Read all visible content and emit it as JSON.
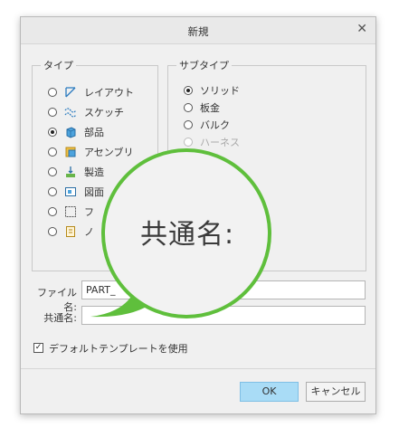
{
  "dialog": {
    "title": "新規",
    "close_glyph": "✕"
  },
  "type_group": {
    "legend": "タイプ",
    "options": [
      {
        "label": "レイアウト",
        "selected": false,
        "icon": "layout-icon"
      },
      {
        "label": "スケッチ",
        "selected": false,
        "icon": "sketch-icon"
      },
      {
        "label": "部品",
        "selected": true,
        "icon": "part-icon"
      },
      {
        "label": "アセンブリ",
        "selected": false,
        "icon": "assembly-icon"
      },
      {
        "label": "製造",
        "selected": false,
        "icon": "manufacturing-icon"
      },
      {
        "label": "図面",
        "selected": false,
        "icon": "drawing-icon"
      },
      {
        "label": "フ",
        "selected": false,
        "icon": "format-icon"
      },
      {
        "label": "ノ",
        "selected": false,
        "icon": "notebook-icon"
      }
    ]
  },
  "subtype_group": {
    "legend": "サブタイプ",
    "options": [
      {
        "label": "ソリッド",
        "selected": true,
        "disabled": false
      },
      {
        "label": "板金",
        "selected": false,
        "disabled": false
      },
      {
        "label": "バルク",
        "selected": false,
        "disabled": false
      },
      {
        "label": "ハーネス",
        "selected": false,
        "disabled": true
      }
    ]
  },
  "fields": {
    "filename_label": "ファイル名:",
    "filename_value": "PART_",
    "common_name_label": "共通名:",
    "common_name_value": ""
  },
  "template_checkbox": {
    "label": "デフォルトテンプレートを使用",
    "checked": true,
    "glyph": "✓"
  },
  "buttons": {
    "ok": "OK",
    "cancel": "キャンセル"
  },
  "magnifier": {
    "text": "共通名:"
  },
  "colors": {
    "accent_green": "#5fbf3c",
    "ok_button": "#a9dcf6"
  }
}
